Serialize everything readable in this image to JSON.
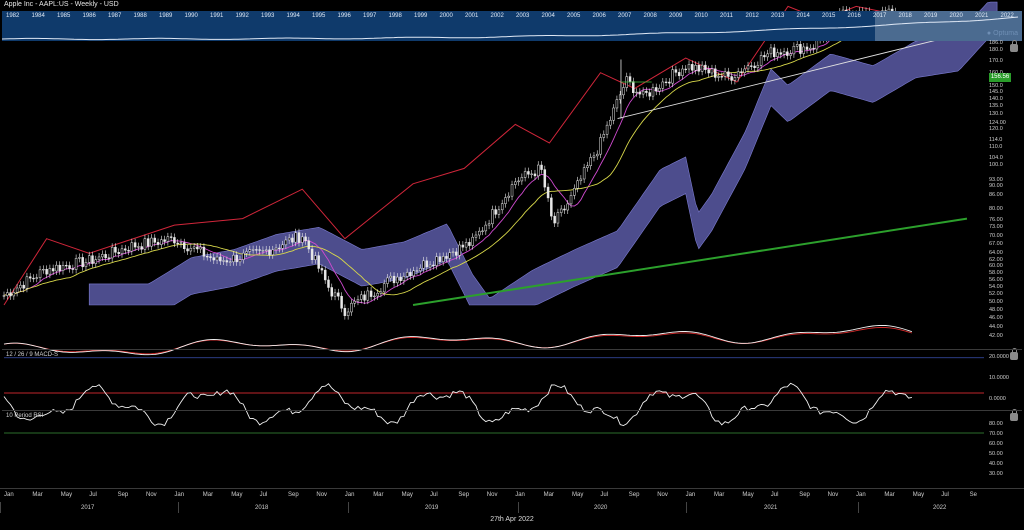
{
  "header": {
    "title": "Apple Inc - AAPL:US - Weekly - USD",
    "logo": "Optuma"
  },
  "overview": {
    "years": [
      "1982",
      "1984",
      "1985",
      "1986",
      "1987",
      "1988",
      "1989",
      "1990",
      "1991",
      "1992",
      "1993",
      "1994",
      "1995",
      "1996",
      "1997",
      "1998",
      "1999",
      "2000",
      "2001",
      "2002",
      "2003",
      "2004",
      "2005",
      "2006",
      "2007",
      "2008",
      "2009",
      "2010",
      "2011",
      "2012",
      "2013",
      "2014",
      "2015",
      "2016",
      "2017",
      "2018",
      "2019",
      "2020",
      "2021",
      "2022"
    ],
    "selected_from": "2017"
  },
  "price_axis": {
    "ticks": [
      "186.0",
      "180.0",
      "170.0",
      "160.0",
      "150.0",
      "145.0",
      "140.0",
      "135.0",
      "130.0",
      "124.00",
      "120.0",
      "114.0",
      "110.0",
      "104.0",
      "100.0",
      "93.00",
      "90.00",
      "86.00",
      "80.00",
      "76.00",
      "73.00",
      "70.00",
      "67.00",
      "64.00",
      "62.00",
      "60.00",
      "58.00",
      "56.00",
      "54.00",
      "52.00",
      "50.00",
      "48.00",
      "46.00",
      "44.00",
      "42.00"
    ],
    "last_price": "156.56"
  },
  "macd": {
    "label": "12 / 26 / 9 MACD-S",
    "ticks": [
      "20.0000",
      "10.0000",
      "0.0000"
    ]
  },
  "rsi": {
    "label": "10 Period RSI",
    "ticks": [
      "80.00",
      "70.00",
      "60.00",
      "50.00",
      "40.00",
      "30.00"
    ]
  },
  "x_axis": {
    "months": [
      "Jan",
      "Mar",
      "May",
      "Jul",
      "Sep",
      "Nov",
      "Jan",
      "Mar",
      "May",
      "Jul",
      "Sep",
      "Nov",
      "Jan",
      "Mar",
      "May",
      "Jul",
      "Sep",
      "Nov",
      "Jan",
      "Mar",
      "May",
      "Jul",
      "Sep",
      "Nov",
      "Jan",
      "Mar",
      "May",
      "Jul",
      "Sep",
      "Nov",
      "Jan",
      "Mar",
      "May",
      "Jul",
      "Se"
    ],
    "years": [
      "2017",
      "2018",
      "2019",
      "2020",
      "2021",
      "2022"
    ]
  },
  "footer": {
    "date": "27th Apr 2022"
  },
  "colors": {
    "overview_bg": "#0f3a6b",
    "cloud": "#5a5aa6",
    "rsi_upper": "#c0262c",
    "rsi_lower": "#2d6e2d",
    "trendline_green": "#2ca02c",
    "price_tag": "#2a9d2a"
  },
  "chart_data": {
    "type": "line",
    "title": "Apple Inc - AAPL:US - Weekly - USD",
    "y_scale": "log",
    "ylim": [
      40,
      186
    ],
    "x_range": [
      "2017-01",
      "2022-09"
    ],
    "series": [
      {
        "type": "candlestick",
        "values_approx": [
          [
            2017.0,
            42
          ],
          [
            2017.25,
            48
          ],
          [
            2017.5,
            50
          ],
          [
            2017.75,
            54
          ],
          [
            2018.0,
            56
          ],
          [
            2018.25,
            50
          ],
          [
            2018.5,
            52
          ],
          [
            2018.75,
            57
          ],
          [
            2018.9,
            44
          ],
          [
            2019.0,
            39
          ],
          [
            2019.25,
            45
          ],
          [
            2019.5,
            50
          ],
          [
            2019.75,
            55
          ],
          [
            2020.0,
            75
          ],
          [
            2020.15,
            80
          ],
          [
            2020.22,
            60
          ],
          [
            2020.3,
            66
          ],
          [
            2020.5,
            91
          ],
          [
            2020.65,
            125
          ],
          [
            2020.75,
            115
          ],
          [
            2021.0,
            135
          ],
          [
            2021.25,
            127
          ],
          [
            2021.5,
            144
          ],
          [
            2021.75,
            149
          ],
          [
            2021.95,
            180
          ],
          [
            2022.1,
            170
          ],
          [
            2022.2,
            177
          ],
          [
            2022.32,
            157
          ]
        ]
      },
      {
        "name": "",
        "values_approx": [
          [
            2017.0,
            40
          ],
          [
            2017.25,
            56
          ],
          [
            2017.5,
            52
          ],
          [
            2018.0,
            60
          ],
          [
            2018.4,
            62
          ],
          [
            2018.75,
            72
          ],
          [
            2019.0,
            56
          ],
          [
            2019.4,
            74
          ],
          [
            2019.7,
            80
          ],
          [
            2020.0,
            100
          ],
          [
            2020.2,
            91
          ],
          [
            2020.5,
            130
          ],
          [
            2020.7,
            120
          ],
          [
            2021.0,
            140
          ],
          [
            2021.3,
            124
          ],
          [
            2021.6,
            182
          ],
          [
            2021.8,
            170
          ],
          [
            2022.0,
            182
          ],
          [
            2022.32,
            172
          ]
        ]
      }
    ],
    "annotations": [
      "Ichimoku cloud",
      "uptrend line (white)",
      "uptrend line (green)"
    ]
  }
}
